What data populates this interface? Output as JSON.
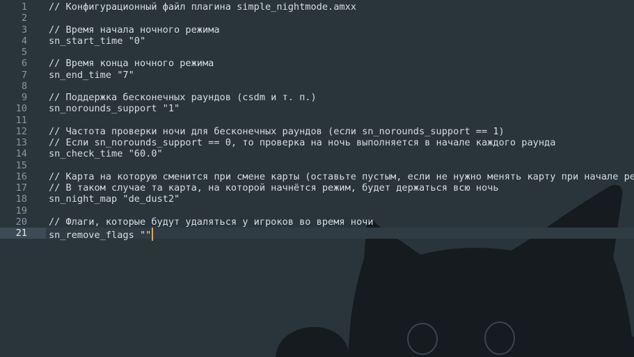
{
  "editor": {
    "caret_line": 21,
    "lines": [
      {
        "num": "1",
        "text": "// Конфигурационный файл плагина simple_nightmode.amxx"
      },
      {
        "num": "2",
        "text": ""
      },
      {
        "num": "3",
        "text": "// Время начала ночного режима"
      },
      {
        "num": "4",
        "text": "sn_start_time \"0\""
      },
      {
        "num": "5",
        "text": ""
      },
      {
        "num": "6",
        "text": "// Время конца ночного режима"
      },
      {
        "num": "7",
        "text": "sn_end_time \"7\""
      },
      {
        "num": "8",
        "text": ""
      },
      {
        "num": "9",
        "text": "// Поддержка бесконечных раундов (csdm и т. п.)"
      },
      {
        "num": "10",
        "text": "sn_norounds_support \"1\""
      },
      {
        "num": "11",
        "text": ""
      },
      {
        "num": "12",
        "text": "// Частота проверки ночи для бесконечных раундов (если sn_norounds_support == 1)"
      },
      {
        "num": "13",
        "text": "// Если sn_norounds_support == 0, то проверка на ночь выполняется в начале каждого раунда"
      },
      {
        "num": "14",
        "text": "sn_check_time \"60.0\""
      },
      {
        "num": "15",
        "text": ""
      },
      {
        "num": "16",
        "text": "// Карта на которую сменится при смене карты (оставьте пустым, если не нужно менять карту при начале режима)"
      },
      {
        "num": "17",
        "text": "// В таком случае та карта, на которой начнётся режим, будет держаться всю ночь"
      },
      {
        "num": "18",
        "text": "sn_night_map \"de_dust2\""
      },
      {
        "num": "19",
        "text": ""
      },
      {
        "num": "20",
        "text": "// Флаги, которые будут удаляться у игроков во время ночи"
      },
      {
        "num": "21",
        "text": "sn_remove_flags \"\""
      }
    ]
  },
  "colors": {
    "background": "#29343b",
    "text": "#d7dde0",
    "gutter_text": "#8a979f",
    "current_line_gutter": "#3c4b55",
    "caret": "#f0a33a",
    "cat_silhouette": "#151b1f"
  },
  "background_art": "cat-silhouette-peeking"
}
